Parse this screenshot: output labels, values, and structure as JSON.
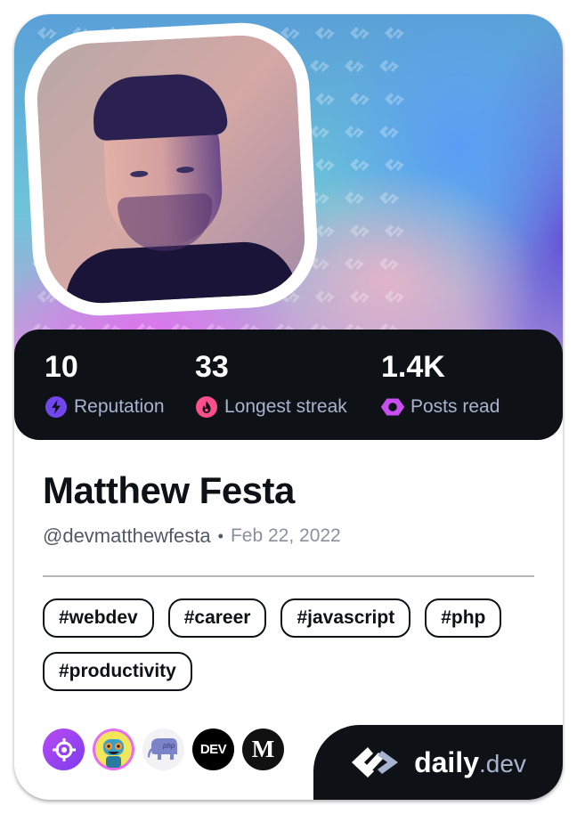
{
  "profile": {
    "name": "Matthew Festa",
    "handle": "@devmatthewfesta",
    "separator": "•",
    "joined": "Feb 22, 2022",
    "avatar_alt": "profile-photo"
  },
  "stats": [
    {
      "value": "10",
      "label": "Reputation",
      "icon": "lightning-bolt-icon",
      "color": "#7147ed"
    },
    {
      "value": "33",
      "label": "Longest streak",
      "icon": "flame-icon",
      "color": "#ff4f8b"
    },
    {
      "value": "1.4K",
      "label": "Posts read",
      "icon": "ring-icon",
      "color": "#c94ef0"
    }
  ],
  "tags": [
    "#webdev",
    "#career",
    "#javascript",
    "#php",
    "#productivity"
  ],
  "sources": [
    {
      "name": "target-source",
      "icon": "crosshair-icon",
      "color": "#a33cf0"
    },
    {
      "name": "robot-source",
      "icon": "robot-avatar-icon",
      "color": "#e86cf0"
    },
    {
      "name": "php-source",
      "icon": "php-elephant-icon",
      "color": "#f2f2f4"
    },
    {
      "name": "dev-to-source",
      "icon": "dev-logo-icon",
      "label": "DEV",
      "color": "#000000"
    },
    {
      "name": "medium-source",
      "icon": "medium-logo-icon",
      "label": "M",
      "color": "#111111"
    }
  ],
  "brand": {
    "name": "daily",
    "tld": ".dev"
  },
  "colors": {
    "dark": "#0e1217",
    "label": "#a8b3cf",
    "reputation": "#7147ed",
    "streak": "#ff4f8b",
    "posts": "#c94ef0"
  }
}
